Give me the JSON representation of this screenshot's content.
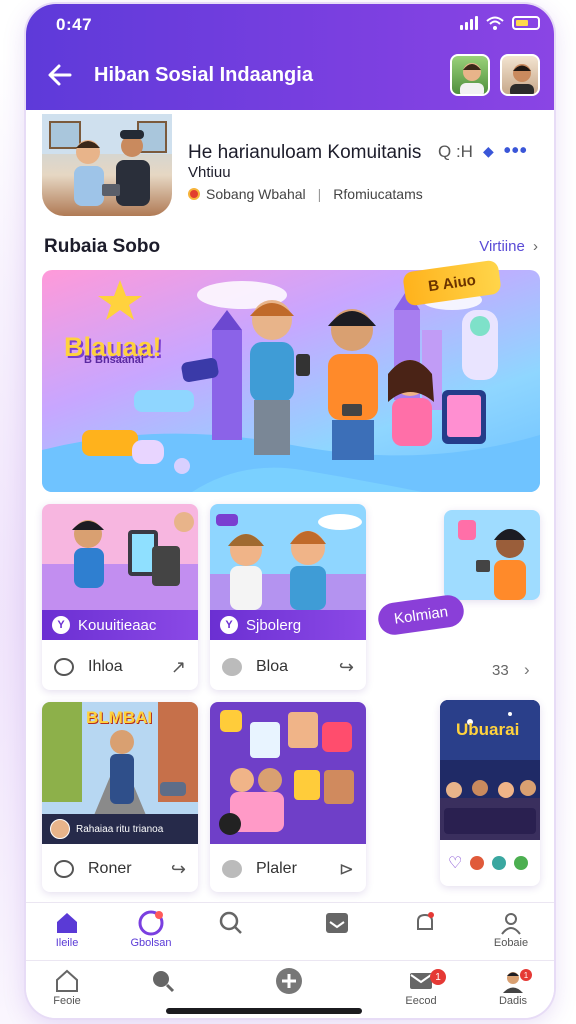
{
  "status": {
    "time": "0:47"
  },
  "header": {
    "title": "Hiban Sosial  Indaangia"
  },
  "profile": {
    "title": "He harianuloam Komuitanis",
    "subtitle": "Vhtiuu",
    "meta_left": "Sobang Wbahal",
    "meta_right": "Rfomiucatams",
    "tools": "Q :H"
  },
  "section": {
    "title": "Rubaia Sobo",
    "link": "Virtiine"
  },
  "hero": {
    "badge": "B Aiuo",
    "title": "Blauaa!",
    "subtitle": "B Bnsaanai"
  },
  "cards": [
    {
      "banner": "Kouuitieaac",
      "action_label": "Ihloa"
    },
    {
      "banner": "Sjbolerg",
      "action_label": "Bloa"
    },
    {
      "banner": "",
      "action_label": ""
    },
    {
      "banner": "Rahaiaa ritu trianoa",
      "action_label": "Roner",
      "image_title": "BLMBAI"
    },
    {
      "banner": "",
      "action_label": "Plaler"
    },
    {
      "banner": "",
      "action_label": "",
      "image_title": "Ubuarai"
    }
  ],
  "floating_tag": "Kolmian",
  "count": "33",
  "tabbar_top": [
    {
      "label": "Ileile",
      "icon": "home-icon"
    },
    {
      "label": "Gbolsan",
      "icon": "profile-ring-icon"
    },
    {
      "label": "",
      "icon": "search-icon"
    },
    {
      "label": "",
      "icon": "inbox-icon"
    },
    {
      "label": "",
      "icon": "bell-icon"
    },
    {
      "label": "Eobaie",
      "icon": "user-icon"
    }
  ],
  "tabbar_bottom": [
    {
      "label": "Feoie",
      "icon": "home-icon"
    },
    {
      "label": "",
      "icon": "search-icon"
    },
    {
      "label": "",
      "icon": "add-icon"
    },
    {
      "label": "Eecod",
      "icon": "mail-icon",
      "badge": "1"
    },
    {
      "label": "Dadis",
      "icon": "avatar-icon",
      "badge": "1"
    }
  ],
  "colors": {
    "header": "#6a3ddc",
    "accent": "#7a3fe0",
    "link": "#5a4bd6"
  }
}
